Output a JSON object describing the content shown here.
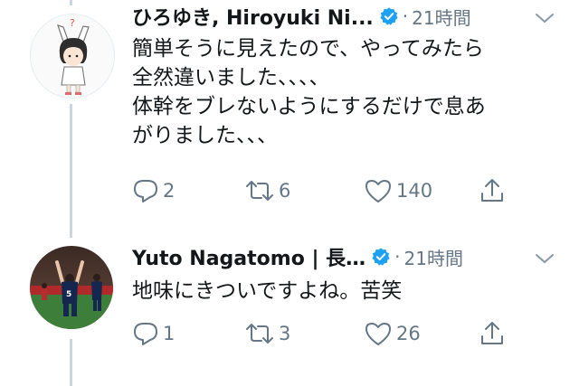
{
  "tweets": [
    {
      "author_name": "ひろゆき, Hiroyuki Ni...",
      "time": "21時間",
      "separator": "·",
      "verified": true,
      "text": "簡単そうに見えたので、やってみたら\n全然違いました、、、、\n体幹をブレないようにするだけで息あ\nがりました、、、",
      "actions": {
        "reply_count": "2",
        "retweet_count": "6",
        "like_count": "140"
      },
      "avatar_icon": "cartoon-character-avatar"
    },
    {
      "author_name": "Yuto Nagatomo | 長…",
      "time": "21時間",
      "separator": "·",
      "verified": true,
      "text": "地味にきついですよね。苦笑",
      "actions": {
        "reply_count": "1",
        "retweet_count": "3",
        "like_count": "26"
      },
      "avatar_icon": "soccer-player-photo-avatar"
    }
  ],
  "colors": {
    "text": "#14171a",
    "secondary": "#657786",
    "verified": "#1da1f2",
    "thread_line": "#ccd6dd"
  }
}
